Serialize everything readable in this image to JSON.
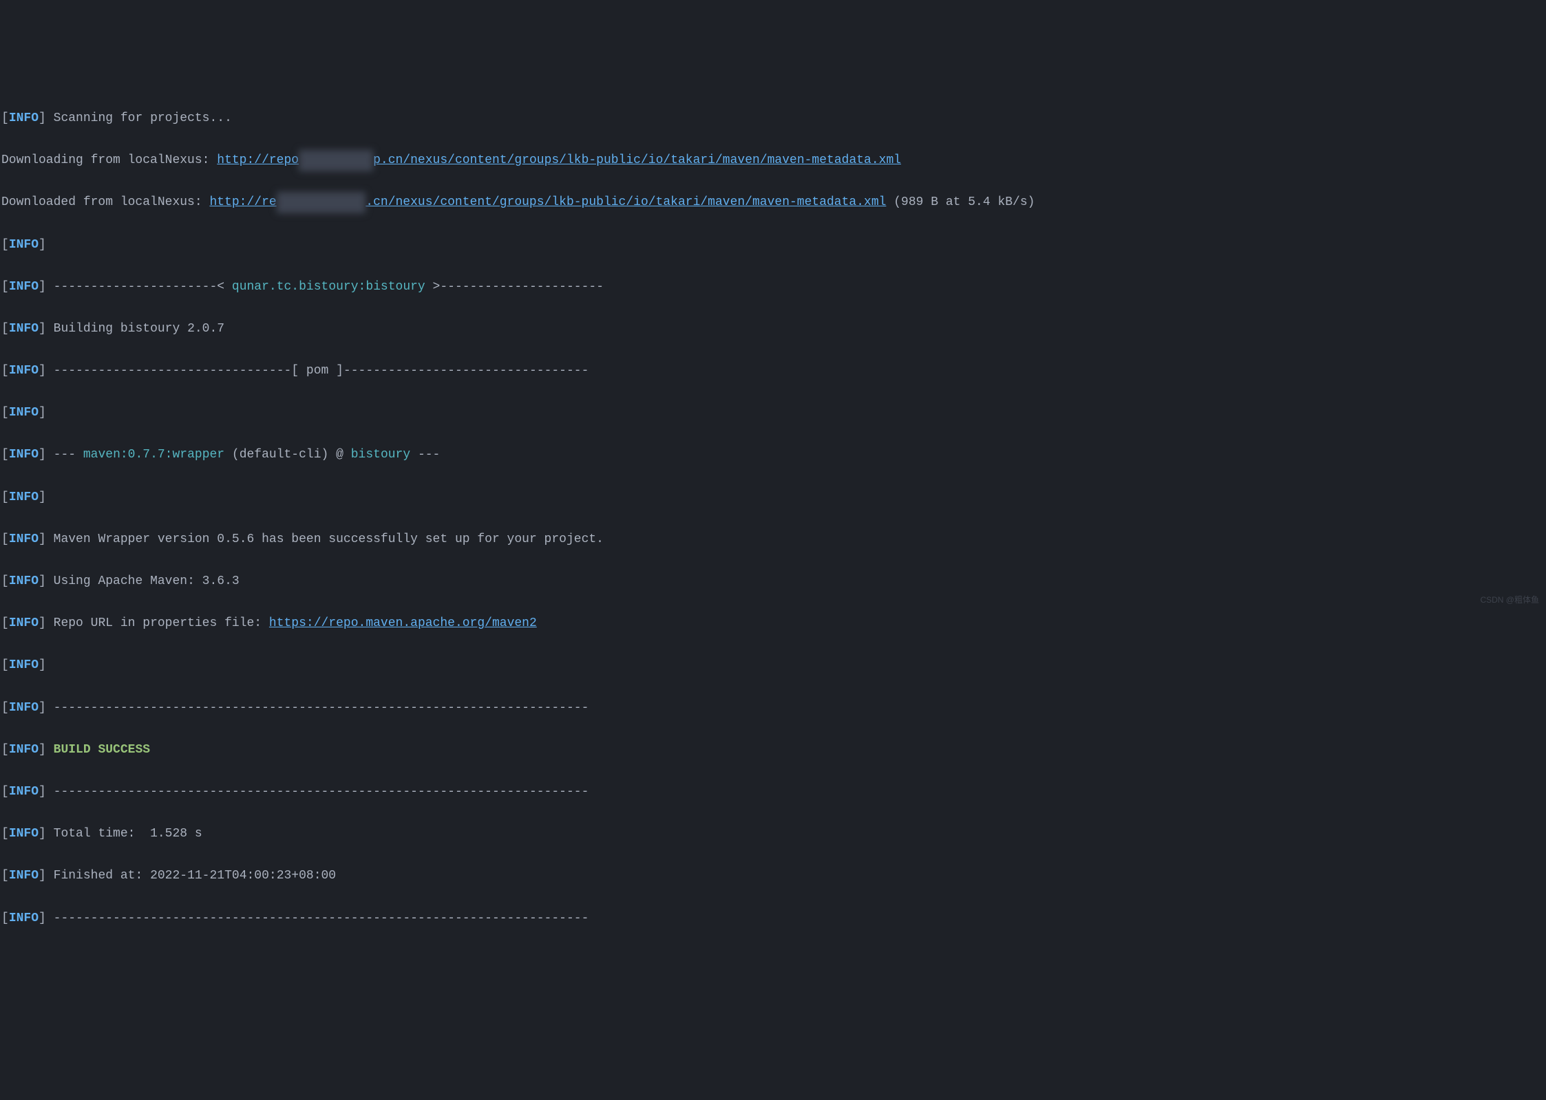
{
  "lines": {
    "l1_info": "INFO",
    "l1_text": " Scanning for projects...",
    "l2_prefix": "Downloading from localNexus: ",
    "l2_link1": "http://repo",
    "l2_link2": "p.cn/nexus/content/groups/lkb-public/io/takari/maven/maven-metadata.xml",
    "l3_prefix": "Downloaded from localNexus: ",
    "l3_link1": "http://re",
    "l3_link2": ".cn/nexus/content/groups/lkb-public/io/takari/maven/maven-metadata.xml",
    "l3_suffix": " (989 B at 5.4 kB/s)",
    "l5_dashes1": " ----------------------< ",
    "l5_project": "qunar.tc.bistoury:bistoury",
    "l5_dashes2": " >----------------------",
    "l6_text": " Building bistoury 2.0.7",
    "l7_dashes1": " --------------------------------[ ",
    "l7_pom": "pom",
    "l7_dashes2": " ]---------------------------------",
    "l9_dashes": " --- ",
    "l9_plugin": "maven:0.7.7:wrapper",
    "l9_mid": " (default-cli) @ ",
    "l9_project": "bistoury",
    "l9_enddash": " ---",
    "l11_text": " Maven Wrapper version 0.5.6 has been successfully set up for your project.",
    "l12_text": " Using Apache Maven: 3.6.3",
    "l13_text": " Repo URL in properties file: ",
    "l13_link": "https://repo.maven.apache.org/maven2",
    "l15_dashes": " ------------------------------------------------------------------------",
    "l16_text": " BUILD SUCCESS",
    "l17_dashes": " ------------------------------------------------------------------------",
    "l18_text": " Total time:  1.528 s",
    "l19_text": " Finished at: 2022-11-21T04:00:23+08:00",
    "l20_dashes": " ------------------------------------------------------------------------"
  },
  "watermark": "CSDN @粗体鱼"
}
